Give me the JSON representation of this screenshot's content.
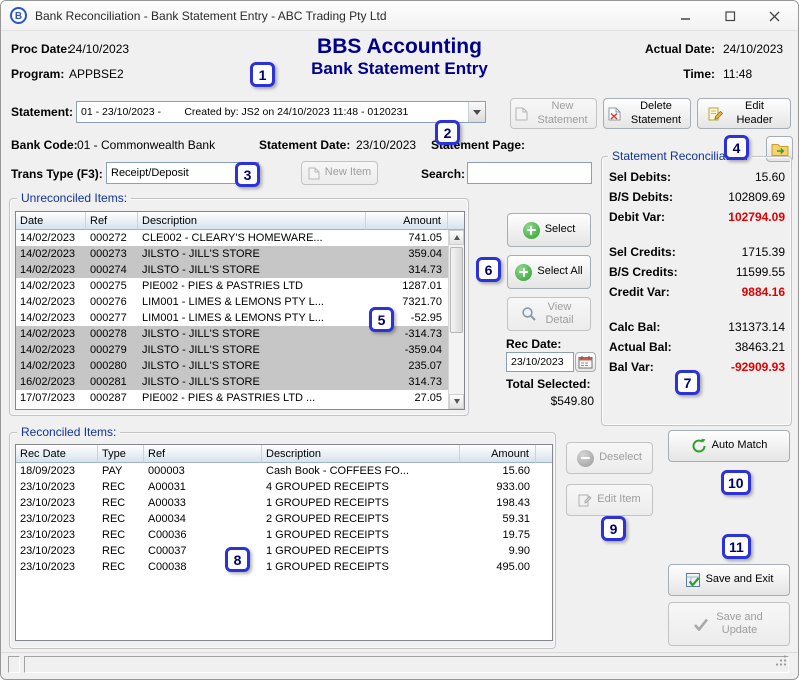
{
  "window": {
    "title": "Bank Reconciliation - Bank Statement Entry - ABC Trading Pty Ltd"
  },
  "header": {
    "proc_date_label": "Proc Date:",
    "proc_date": "24/10/2023",
    "program_label": "Program:",
    "program": "APPBSE2",
    "app_title": "BBS Accounting",
    "screen_title": "Bank Statement Entry",
    "actual_date_label": "Actual Date:",
    "actual_date": "24/10/2023",
    "time_label": "Time:",
    "time": "11:48"
  },
  "statement": {
    "label": "Statement:",
    "value": "01 - 23/10/2023 -        Created by: JS2 on 24/10/2023 11:48 - 0120231",
    "new_button": "New Statement",
    "delete_button": "Delete Statement",
    "edit_button": "Edit Header"
  },
  "bank": {
    "bank_code_label": "Bank Code:",
    "bank_code": "01 - Commonwealth Bank",
    "statement_date_label": "Statement Date:",
    "statement_date": "23/10/2023",
    "statement_page_label": "Statement Page:"
  },
  "trans": {
    "label": "Trans Type (F3):",
    "value": "Receipt/Deposit",
    "new_item_button": "New Item",
    "search_label": "Search:",
    "search_value": ""
  },
  "unreconciled": {
    "group_label": "Unreconciled Items:",
    "columns": [
      "Date",
      "Ref",
      "Description",
      "Amount"
    ],
    "rows": [
      {
        "date": "14/02/2023",
        "ref": "000272",
        "description": "CLE002 - CLEARY'S HOMEWARE...",
        "amount": "741.05",
        "selected": false
      },
      {
        "date": "14/02/2023",
        "ref": "000273",
        "description": "JILSTO - JILL'S STORE",
        "amount": "359.04",
        "selected": true
      },
      {
        "date": "14/02/2023",
        "ref": "000274",
        "description": "JILSTO - JILL'S STORE",
        "amount": "314.73",
        "selected": true
      },
      {
        "date": "14/02/2023",
        "ref": "000275",
        "description": "PIE002 - PIES & PASTRIES LTD",
        "amount": "1287.01",
        "selected": false
      },
      {
        "date": "14/02/2023",
        "ref": "000276",
        "description": "LIM001 - LIMES & LEMONS PTY L...",
        "amount": "7321.70",
        "selected": false
      },
      {
        "date": "14/02/2023",
        "ref": "000277",
        "description": "LIM001 - LIMES & LEMONS PTY L...",
        "amount": "-52.95",
        "selected": false
      },
      {
        "date": "14/02/2023",
        "ref": "000278",
        "description": "JILSTO - JILL'S STORE",
        "amount": "-314.73",
        "selected": true
      },
      {
        "date": "14/02/2023",
        "ref": "000279",
        "description": "JILSTO - JILL'S STORE",
        "amount": "-359.04",
        "selected": true
      },
      {
        "date": "14/02/2023",
        "ref": "000280",
        "description": "JILSTO - JILL'S STORE",
        "amount": "235.07",
        "selected": true
      },
      {
        "date": "16/02/2023",
        "ref": "000281",
        "description": "JILSTO - JILL'S STORE",
        "amount": "314.73",
        "selected": true
      },
      {
        "date": "17/07/2023",
        "ref": "000287",
        "description": "PIE002 - PIES & PASTRIES LTD ...",
        "amount": "27.05",
        "selected": false
      }
    ],
    "select_button": "Select",
    "select_all_button": "Select All",
    "view_detail_button": "View Detail",
    "rec_date_label": "Rec Date:",
    "rec_date": "23/10/2023",
    "total_selected_label": "Total Selected:",
    "total_selected": "$549.80"
  },
  "reconciliation": {
    "group_label": "Statement Reconciliation:",
    "groups": [
      {
        "rows": [
          {
            "label": "Sel Debits:",
            "value": "15.60"
          },
          {
            "label": "B/S Debits:",
            "value": "102809.69"
          },
          {
            "label": "Debit Var:",
            "value": "102794.09",
            "alert": true
          }
        ]
      },
      {
        "rows": [
          {
            "label": "Sel Credits:",
            "value": "1715.39"
          },
          {
            "label": "B/S Credits:",
            "value": "11599.55"
          },
          {
            "label": "Credit Var:",
            "value": "9884.16",
            "alert": true
          }
        ]
      },
      {
        "rows": [
          {
            "label": "Calc Bal:",
            "value": "131373.14"
          },
          {
            "label": "Actual Bal:",
            "value": "38463.21"
          },
          {
            "label": "Bal Var:",
            "value": "-92909.93",
            "alert": true
          }
        ]
      }
    ]
  },
  "reconciled": {
    "group_label": "Reconciled Items:",
    "columns": [
      "Rec Date",
      "Type",
      "Ref",
      "Description",
      "Amount"
    ],
    "rows": [
      {
        "rec_date": "18/09/2023",
        "type": "PAY",
        "ref": "000003",
        "description": "Cash Book - COFFEES FO...",
        "amount": "15.60"
      },
      {
        "rec_date": "23/10/2023",
        "type": "REC",
        "ref": "A00031",
        "description": "4 GROUPED RECEIPTS",
        "amount": "933.00"
      },
      {
        "rec_date": "23/10/2023",
        "type": "REC",
        "ref": "A00033",
        "description": "1 GROUPED RECEIPTS",
        "amount": "198.43"
      },
      {
        "rec_date": "23/10/2023",
        "type": "REC",
        "ref": "A00034",
        "description": "2 GROUPED RECEIPTS",
        "amount": "59.31"
      },
      {
        "rec_date": "23/10/2023",
        "type": "REC",
        "ref": "C00036",
        "description": "1 GROUPED RECEIPTS",
        "amount": "19.75"
      },
      {
        "rec_date": "23/10/2023",
        "type": "REC",
        "ref": "C00037",
        "description": "1 GROUPED RECEIPTS",
        "amount": "9.90"
      },
      {
        "rec_date": "23/10/2023",
        "type": "REC",
        "ref": "C00038",
        "description": "1 GROUPED RECEIPTS",
        "amount": "495.00"
      }
    ],
    "deselect_button": "Deselect",
    "edit_item_button": "Edit Item"
  },
  "actions": {
    "auto_match": "Auto Match",
    "save_and_exit": "Save and Exit",
    "save_and_update": "Save and Update"
  },
  "callouts": [
    "1",
    "2",
    "3",
    "4",
    "5",
    "6",
    "7",
    "8",
    "9",
    "10",
    "11"
  ],
  "colors": {
    "accent_navy": "#00008c",
    "alert_red": "#dd0000",
    "selected_row_gray": "#c6c6c6",
    "callout_blue": "#2b32d8"
  }
}
